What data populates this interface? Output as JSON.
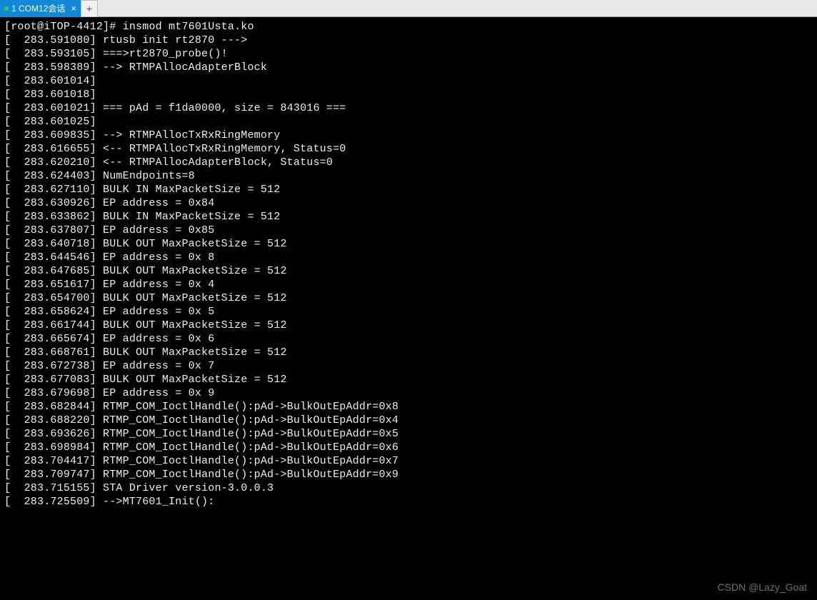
{
  "tabs": {
    "active": {
      "index": "1",
      "label": "COM12会话",
      "close": "×"
    },
    "add": "+"
  },
  "terminal": {
    "prompt": "[root@iTOP-4412]# ",
    "command": "insmod mt7601Usta.ko",
    "lines": [
      "[  283.591080] rtusb init rt2870 --->",
      "[  283.593105] ===>rt2870_probe()!",
      "[  283.598389] --> RTMPAllocAdapterBlock",
      "[  283.601014] ",
      "[  283.601018] ",
      "[  283.601021] === pAd = f1da0000, size = 843016 ===",
      "[  283.601025] ",
      "[  283.609835] --> RTMPAllocTxRxRingMemory",
      "[  283.616655] <-- RTMPAllocTxRxRingMemory, Status=0",
      "[  283.620210] <-- RTMPAllocAdapterBlock, Status=0",
      "[  283.624403] NumEndpoints=8",
      "[  283.627110] BULK IN MaxPacketSize = 512",
      "[  283.630926] EP address = 0x84",
      "[  283.633862] BULK IN MaxPacketSize = 512",
      "[  283.637807] EP address = 0x85",
      "[  283.640718] BULK OUT MaxPacketSize = 512",
      "[  283.644546] EP address = 0x 8",
      "[  283.647685] BULK OUT MaxPacketSize = 512",
      "[  283.651617] EP address = 0x 4",
      "[  283.654700] BULK OUT MaxPacketSize = 512",
      "[  283.658624] EP address = 0x 5",
      "[  283.661744] BULK OUT MaxPacketSize = 512",
      "[  283.665674] EP address = 0x 6",
      "[  283.668761] BULK OUT MaxPacketSize = 512",
      "[  283.672738] EP address = 0x 7",
      "[  283.677083] BULK OUT MaxPacketSize = 512",
      "[  283.679698] EP address = 0x 9",
      "[  283.682844] RTMP_COM_IoctlHandle():pAd->BulkOutEpAddr=0x8",
      "[  283.688220] RTMP_COM_IoctlHandle():pAd->BulkOutEpAddr=0x4",
      "[  283.693626] RTMP_COM_IoctlHandle():pAd->BulkOutEpAddr=0x5",
      "[  283.698984] RTMP_COM_IoctlHandle():pAd->BulkOutEpAddr=0x6",
      "[  283.704417] RTMP_COM_IoctlHandle():pAd->BulkOutEpAddr=0x7",
      "[  283.709747] RTMP_COM_IoctlHandle():pAd->BulkOutEpAddr=0x9",
      "[  283.715155] STA Driver version-3.0.0.3",
      "[  283.725509] -->MT7601_Init():"
    ]
  },
  "watermark": "CSDN @Lazy_Goat"
}
